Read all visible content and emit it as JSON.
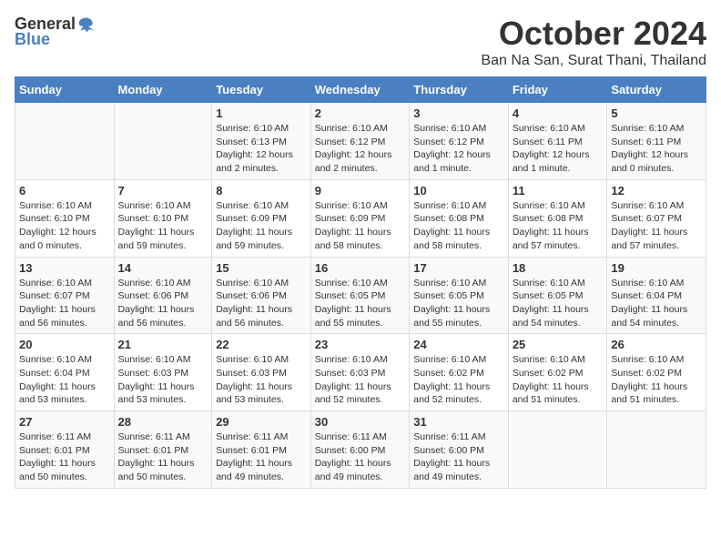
{
  "logo": {
    "general": "General",
    "blue": "Blue"
  },
  "title": "October 2024",
  "subtitle": "Ban Na San, Surat Thani, Thailand",
  "headers": [
    "Sunday",
    "Monday",
    "Tuesday",
    "Wednesday",
    "Thursday",
    "Friday",
    "Saturday"
  ],
  "weeks": [
    [
      {
        "day": "",
        "info": ""
      },
      {
        "day": "",
        "info": ""
      },
      {
        "day": "1",
        "info": "Sunrise: 6:10 AM\nSunset: 6:13 PM\nDaylight: 12 hours\nand 2 minutes."
      },
      {
        "day": "2",
        "info": "Sunrise: 6:10 AM\nSunset: 6:12 PM\nDaylight: 12 hours\nand 2 minutes."
      },
      {
        "day": "3",
        "info": "Sunrise: 6:10 AM\nSunset: 6:12 PM\nDaylight: 12 hours\nand 1 minute."
      },
      {
        "day": "4",
        "info": "Sunrise: 6:10 AM\nSunset: 6:11 PM\nDaylight: 12 hours\nand 1 minute."
      },
      {
        "day": "5",
        "info": "Sunrise: 6:10 AM\nSunset: 6:11 PM\nDaylight: 12 hours\nand 0 minutes."
      }
    ],
    [
      {
        "day": "6",
        "info": "Sunrise: 6:10 AM\nSunset: 6:10 PM\nDaylight: 12 hours\nand 0 minutes."
      },
      {
        "day": "7",
        "info": "Sunrise: 6:10 AM\nSunset: 6:10 PM\nDaylight: 11 hours\nand 59 minutes."
      },
      {
        "day": "8",
        "info": "Sunrise: 6:10 AM\nSunset: 6:09 PM\nDaylight: 11 hours\nand 59 minutes."
      },
      {
        "day": "9",
        "info": "Sunrise: 6:10 AM\nSunset: 6:09 PM\nDaylight: 11 hours\nand 58 minutes."
      },
      {
        "day": "10",
        "info": "Sunrise: 6:10 AM\nSunset: 6:08 PM\nDaylight: 11 hours\nand 58 minutes."
      },
      {
        "day": "11",
        "info": "Sunrise: 6:10 AM\nSunset: 6:08 PM\nDaylight: 11 hours\nand 57 minutes."
      },
      {
        "day": "12",
        "info": "Sunrise: 6:10 AM\nSunset: 6:07 PM\nDaylight: 11 hours\nand 57 minutes."
      }
    ],
    [
      {
        "day": "13",
        "info": "Sunrise: 6:10 AM\nSunset: 6:07 PM\nDaylight: 11 hours\nand 56 minutes."
      },
      {
        "day": "14",
        "info": "Sunrise: 6:10 AM\nSunset: 6:06 PM\nDaylight: 11 hours\nand 56 minutes."
      },
      {
        "day": "15",
        "info": "Sunrise: 6:10 AM\nSunset: 6:06 PM\nDaylight: 11 hours\nand 56 minutes."
      },
      {
        "day": "16",
        "info": "Sunrise: 6:10 AM\nSunset: 6:05 PM\nDaylight: 11 hours\nand 55 minutes."
      },
      {
        "day": "17",
        "info": "Sunrise: 6:10 AM\nSunset: 6:05 PM\nDaylight: 11 hours\nand 55 minutes."
      },
      {
        "day": "18",
        "info": "Sunrise: 6:10 AM\nSunset: 6:05 PM\nDaylight: 11 hours\nand 54 minutes."
      },
      {
        "day": "19",
        "info": "Sunrise: 6:10 AM\nSunset: 6:04 PM\nDaylight: 11 hours\nand 54 minutes."
      }
    ],
    [
      {
        "day": "20",
        "info": "Sunrise: 6:10 AM\nSunset: 6:04 PM\nDaylight: 11 hours\nand 53 minutes."
      },
      {
        "day": "21",
        "info": "Sunrise: 6:10 AM\nSunset: 6:03 PM\nDaylight: 11 hours\nand 53 minutes."
      },
      {
        "day": "22",
        "info": "Sunrise: 6:10 AM\nSunset: 6:03 PM\nDaylight: 11 hours\nand 53 minutes."
      },
      {
        "day": "23",
        "info": "Sunrise: 6:10 AM\nSunset: 6:03 PM\nDaylight: 11 hours\nand 52 minutes."
      },
      {
        "day": "24",
        "info": "Sunrise: 6:10 AM\nSunset: 6:02 PM\nDaylight: 11 hours\nand 52 minutes."
      },
      {
        "day": "25",
        "info": "Sunrise: 6:10 AM\nSunset: 6:02 PM\nDaylight: 11 hours\nand 51 minutes."
      },
      {
        "day": "26",
        "info": "Sunrise: 6:10 AM\nSunset: 6:02 PM\nDaylight: 11 hours\nand 51 minutes."
      }
    ],
    [
      {
        "day": "27",
        "info": "Sunrise: 6:11 AM\nSunset: 6:01 PM\nDaylight: 11 hours\nand 50 minutes."
      },
      {
        "day": "28",
        "info": "Sunrise: 6:11 AM\nSunset: 6:01 PM\nDaylight: 11 hours\nand 50 minutes."
      },
      {
        "day": "29",
        "info": "Sunrise: 6:11 AM\nSunset: 6:01 PM\nDaylight: 11 hours\nand 49 minutes."
      },
      {
        "day": "30",
        "info": "Sunrise: 6:11 AM\nSunset: 6:00 PM\nDaylight: 11 hours\nand 49 minutes."
      },
      {
        "day": "31",
        "info": "Sunrise: 6:11 AM\nSunset: 6:00 PM\nDaylight: 11 hours\nand 49 minutes."
      },
      {
        "day": "",
        "info": ""
      },
      {
        "day": "",
        "info": ""
      }
    ]
  ]
}
